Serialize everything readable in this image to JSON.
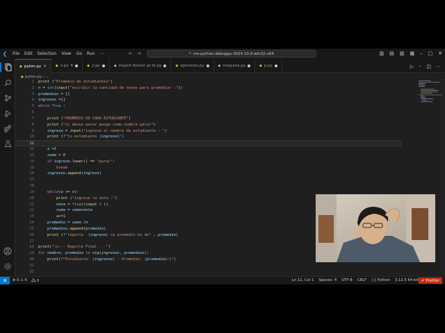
{
  "titlebar": {
    "menu": [
      "File",
      "Edit",
      "Selection",
      "View",
      "Go",
      "Run",
      "⋯"
    ],
    "command_center": "ms-python.debugpy-2024.10.0-win32-x64"
  },
  "tabs": [
    {
      "label": "pyton.py",
      "active": true,
      "closable": true
    },
    {
      "label": "n.py",
      "badge": "6"
    },
    {
      "label": "2.py"
    },
    {
      "label": "import tkinter as tk.py"
    },
    {
      "label": "ejercicios.py"
    },
    {
      "label": "maquina.py"
    },
    {
      "label": "p.py"
    }
  ],
  "breadcrumb": {
    "file": "pyton.py",
    "more": "..."
  },
  "editor": {
    "current_line": 11,
    "lines": [
      {
        "n": "1"
      },
      {
        "n": "2"
      },
      {
        "n": "3"
      },
      {
        "n": "4"
      },
      {
        "n": "5"
      },
      {
        "n": "6"
      },
      {
        "n": "7"
      },
      {
        "n": "8"
      },
      {
        "n": "9"
      },
      {
        "n": "10"
      },
      {
        "n": "11"
      },
      {
        "n": "12"
      },
      {
        "n": "13"
      },
      {
        "n": "14"
      },
      {
        "n": "15"
      },
      {
        "n": "16"
      },
      {
        "n": "17"
      },
      {
        "n": "18"
      },
      {
        "n": "19"
      },
      {
        "n": "20"
      },
      {
        "n": "21"
      },
      {
        "n": "22"
      },
      {
        "n": "23"
      },
      {
        "n": "24"
      },
      {
        "n": "25"
      },
      {
        "n": "26"
      },
      {
        "n": "27"
      },
      {
        "n": "28"
      },
      {
        "n": "29"
      },
      {
        "n": "30"
      },
      {
        "n": "31"
      },
      {
        "n": "32"
      }
    ]
  },
  "status": {
    "problems_errors": "0",
    "problems_warnings": "6",
    "ports": "0",
    "cursor": "Ln 11, Col 1",
    "indent": "Spaces: 4",
    "encoding": "UTF-8",
    "eol": "CRLF",
    "language": "Python",
    "interpreter": "3.12.5 64-bit",
    "prettier": "Prettier"
  },
  "colors": {
    "accent": "#0078d4",
    "editor_bg": "#1f1f1f",
    "chrome_bg": "#181818",
    "prettier_bg": "#c72e0f"
  }
}
